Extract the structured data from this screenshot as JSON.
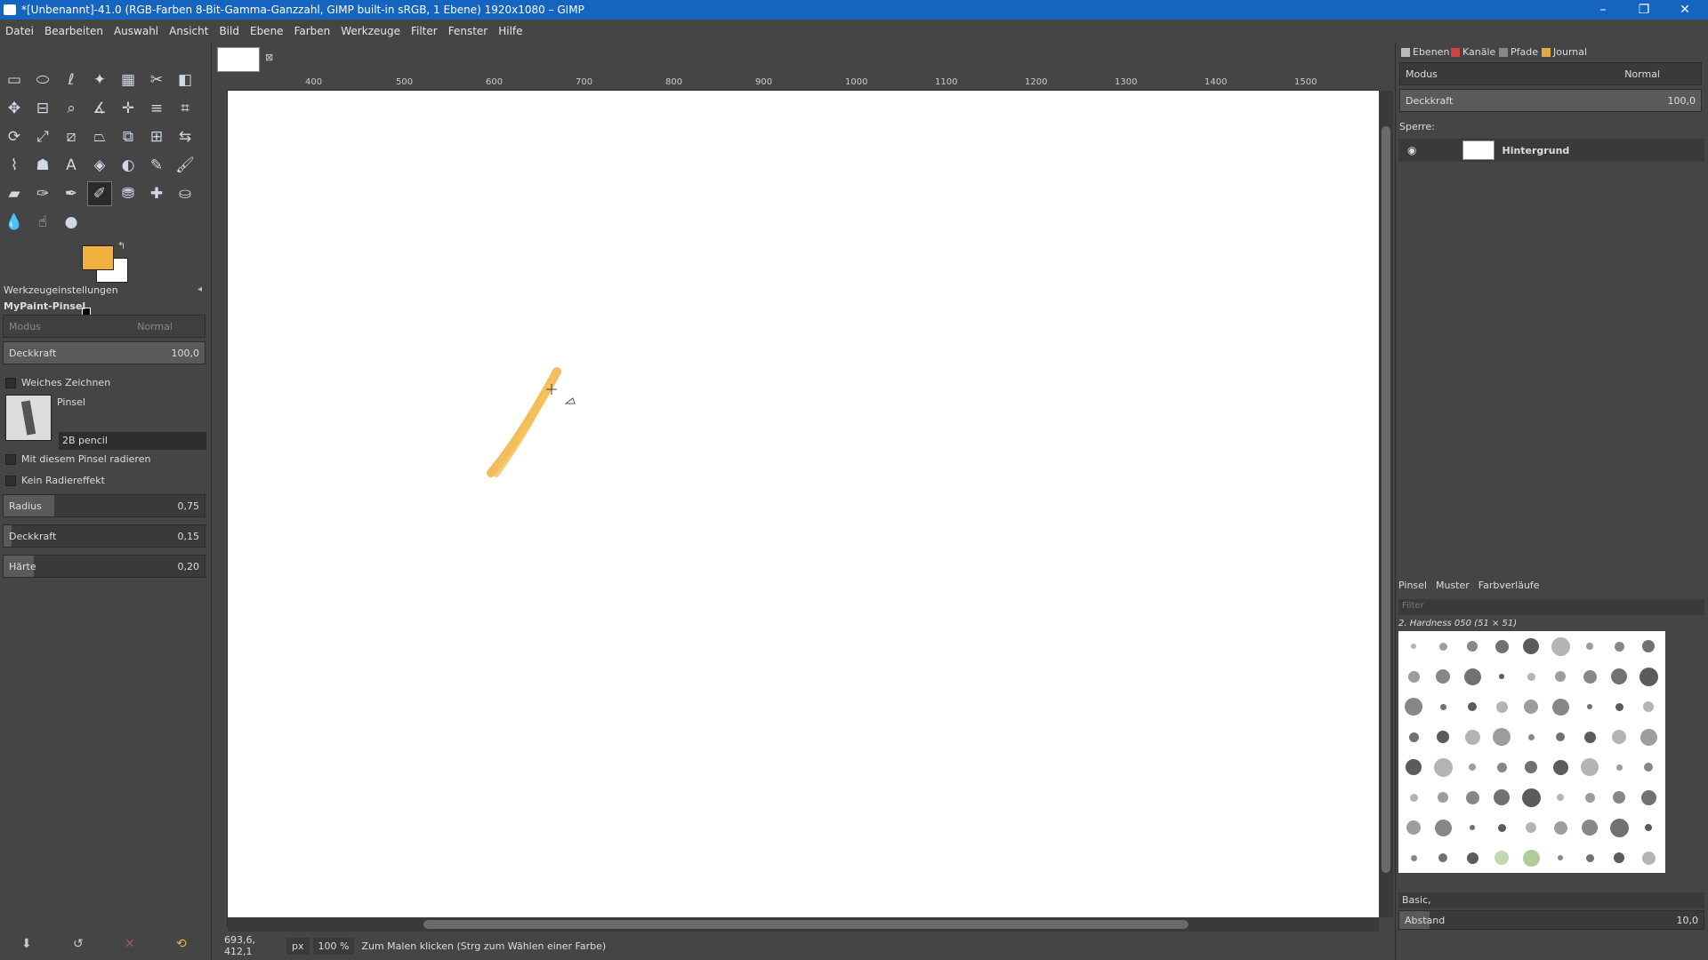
{
  "window": {
    "title": "*[Unbenannt]-41.0 (RGB-Farben 8-Bit-Gamma-Ganzzahl, GIMP built-in sRGB, 1 Ebene) 1920x1080 – GIMP",
    "min": "–",
    "max": "❐",
    "close": "✕"
  },
  "menu": [
    "Datei",
    "Bearbeiten",
    "Auswahl",
    "Ansicht",
    "Bild",
    "Ebene",
    "Farben",
    "Werkzeuge",
    "Filter",
    "Fenster",
    "Hilfe"
  ],
  "colors": {
    "foreground": "#f0b141",
    "background": "#ffffff"
  },
  "tool_options": {
    "tab_label": "Werkzeugeinstellungen",
    "tool_name": "MyPaint-Pinsel",
    "mode_label": "Modus",
    "mode_value": "Normal",
    "opacity_label": "Deckkraft",
    "opacity_value": "100,0",
    "smooth_label": "Weiches Zeichnen",
    "brush_label": "Pinsel",
    "brush_value": "2B pencil",
    "erase_label": "Mit diesem Pinsel radieren",
    "no_erase_label": "Kein Radiereffekt",
    "radius_label": "Radius",
    "radius_value": "0,75",
    "opacity2_label": "Deckkraft",
    "opacity2_value": "0,15",
    "hardness_label": "Härte",
    "hardness_value": "0,20"
  },
  "ruler_ticks": [
    "400",
    "500",
    "600",
    "700",
    "800",
    "900",
    "1000",
    "1100",
    "1200",
    "1300",
    "1400",
    "1500"
  ],
  "statusbar": {
    "coords": "693,6, 412,1",
    "unit": "px",
    "zoom": "100 %",
    "message": "Zum Malen klicken (Strg zum Wählen einer Farbe)"
  },
  "layers_panel": {
    "tabs": [
      "Ebenen",
      "Kanäle",
      "Pfade",
      "Journal"
    ],
    "mode_label": "Modus",
    "mode_value": "Normal",
    "opacity_label": "Deckkraft",
    "opacity_value": "100,0",
    "lock_label": "Sperre:",
    "layer_name": "Hintergrund"
  },
  "brushes_panel": {
    "tabs": [
      "Pinsel",
      "Muster",
      "Farbverläufe"
    ],
    "filter_placeholder": "Filter",
    "selected_brush": "2. Hardness 050 (51 × 51)",
    "tag": "Basic,",
    "spacing_label": "Abstand",
    "spacing_value": "10,0"
  }
}
